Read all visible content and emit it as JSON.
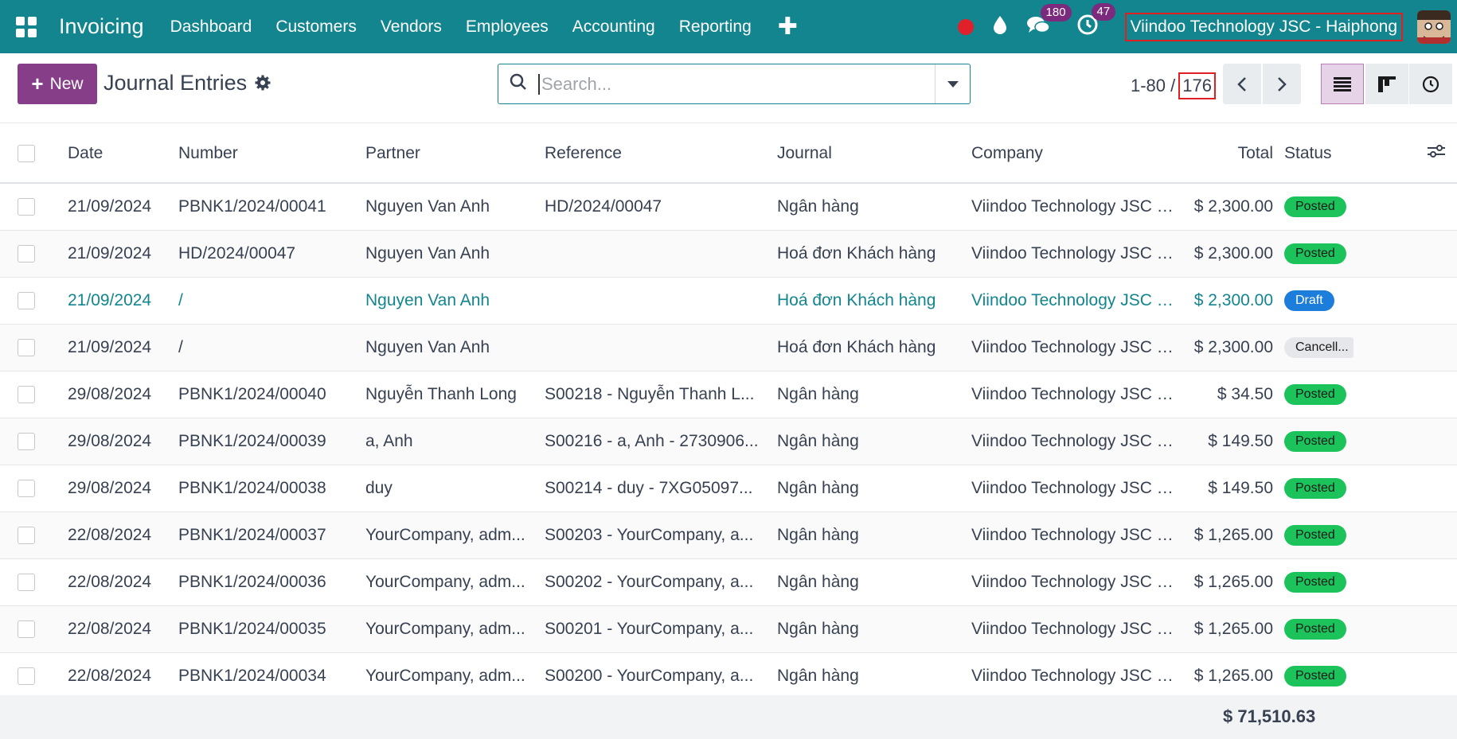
{
  "navbar": {
    "brand": "Invoicing",
    "menu": [
      "Dashboard",
      "Customers",
      "Vendors",
      "Employees",
      "Accounting",
      "Reporting"
    ],
    "messages_count": "180",
    "activities_count": "47",
    "company": "Viindoo Technology JSC - Haiphong"
  },
  "control": {
    "new_label": "New",
    "title": "Journal Entries",
    "search_placeholder": "Search...",
    "pager_range": "1-80 /",
    "pager_total": "176"
  },
  "table": {
    "headers": [
      "Date",
      "Number",
      "Partner",
      "Reference",
      "Journal",
      "Company",
      "Total",
      "Status"
    ],
    "rows": [
      {
        "date": "21/09/2024",
        "number": "PBNK1/2024/00041",
        "partner": "Nguyen Van Anh",
        "reference": "HD/2024/00047",
        "journal": "Ngân hàng",
        "company": "Viindoo Technology JSC - ...",
        "total": "$ 2,300.00",
        "status": "Posted"
      },
      {
        "date": "21/09/2024",
        "number": "HD/2024/00047",
        "partner": "Nguyen Van Anh",
        "reference": "",
        "journal": "Hoá đơn Khách hàng",
        "company": "Viindoo Technology JSC - ...",
        "total": "$ 2,300.00",
        "status": "Posted"
      },
      {
        "date": "21/09/2024",
        "number": "/",
        "partner": "Nguyen Van Anh",
        "reference": "",
        "journal": "Hoá đơn Khách hàng",
        "company": "Viindoo Technology JSC - ...",
        "total": "$ 2,300.00",
        "status": "Draft"
      },
      {
        "date": "21/09/2024",
        "number": "/",
        "partner": "Nguyen Van Anh",
        "reference": "",
        "journal": "Hoá đơn Khách hàng",
        "company": "Viindoo Technology JSC - ...",
        "total": "$ 2,300.00",
        "status": "Cancell..."
      },
      {
        "date": "29/08/2024",
        "number": "PBNK1/2024/00040",
        "partner": "Nguyễn Thanh Long",
        "reference": "S00218 - Nguyễn Thanh L...",
        "journal": "Ngân hàng",
        "company": "Viindoo Technology JSC - ...",
        "total": "$ 34.50",
        "status": "Posted"
      },
      {
        "date": "29/08/2024",
        "number": "PBNK1/2024/00039",
        "partner": "a, Anh",
        "reference": "S00216 - a, Anh - 2730906...",
        "journal": "Ngân hàng",
        "company": "Viindoo Technology JSC - ...",
        "total": "$ 149.50",
        "status": "Posted"
      },
      {
        "date": "29/08/2024",
        "number": "PBNK1/2024/00038",
        "partner": "duy",
        "reference": "S00214 - duy - 7XG05097...",
        "journal": "Ngân hàng",
        "company": "Viindoo Technology JSC - ...",
        "total": "$ 149.50",
        "status": "Posted"
      },
      {
        "date": "22/08/2024",
        "number": "PBNK1/2024/00037",
        "partner": "YourCompany, adm...",
        "reference": "S00203 - YourCompany, a...",
        "journal": "Ngân hàng",
        "company": "Viindoo Technology JSC - ...",
        "total": "$ 1,265.00",
        "status": "Posted"
      },
      {
        "date": "22/08/2024",
        "number": "PBNK1/2024/00036",
        "partner": "YourCompany, adm...",
        "reference": "S00202 - YourCompany, a...",
        "journal": "Ngân hàng",
        "company": "Viindoo Technology JSC - ...",
        "total": "$ 1,265.00",
        "status": "Posted"
      },
      {
        "date": "22/08/2024",
        "number": "PBNK1/2024/00035",
        "partner": "YourCompany, adm...",
        "reference": "S00201 - YourCompany, a...",
        "journal": "Ngân hàng",
        "company": "Viindoo Technology JSC - ...",
        "total": "$ 1,265.00",
        "status": "Posted"
      },
      {
        "date": "22/08/2024",
        "number": "PBNK1/2024/00034",
        "partner": "YourCompany, adm...",
        "reference": "S00200 - YourCompany, a...",
        "journal": "Ngân hàng",
        "company": "Viindoo Technology JSC - ...",
        "total": "$ 1,265.00",
        "status": "Posted"
      }
    ],
    "grand_total": "$ 71,510.63"
  },
  "colors": {
    "navbar": "#12858f",
    "primary": "#873e89",
    "posted": "#1bc35a",
    "draft": "#1d7ddb"
  },
  "icons": [
    "apps-grid-icon",
    "plus-icon",
    "record-icon",
    "drop-icon",
    "chat-icon",
    "activity-clock-icon",
    "gear-icon",
    "search-icon",
    "caret-down-icon",
    "chevron-left-icon",
    "chevron-right-icon",
    "list-view-icon",
    "kanban-view-icon",
    "activity-view-icon",
    "column-settings-icon"
  ]
}
